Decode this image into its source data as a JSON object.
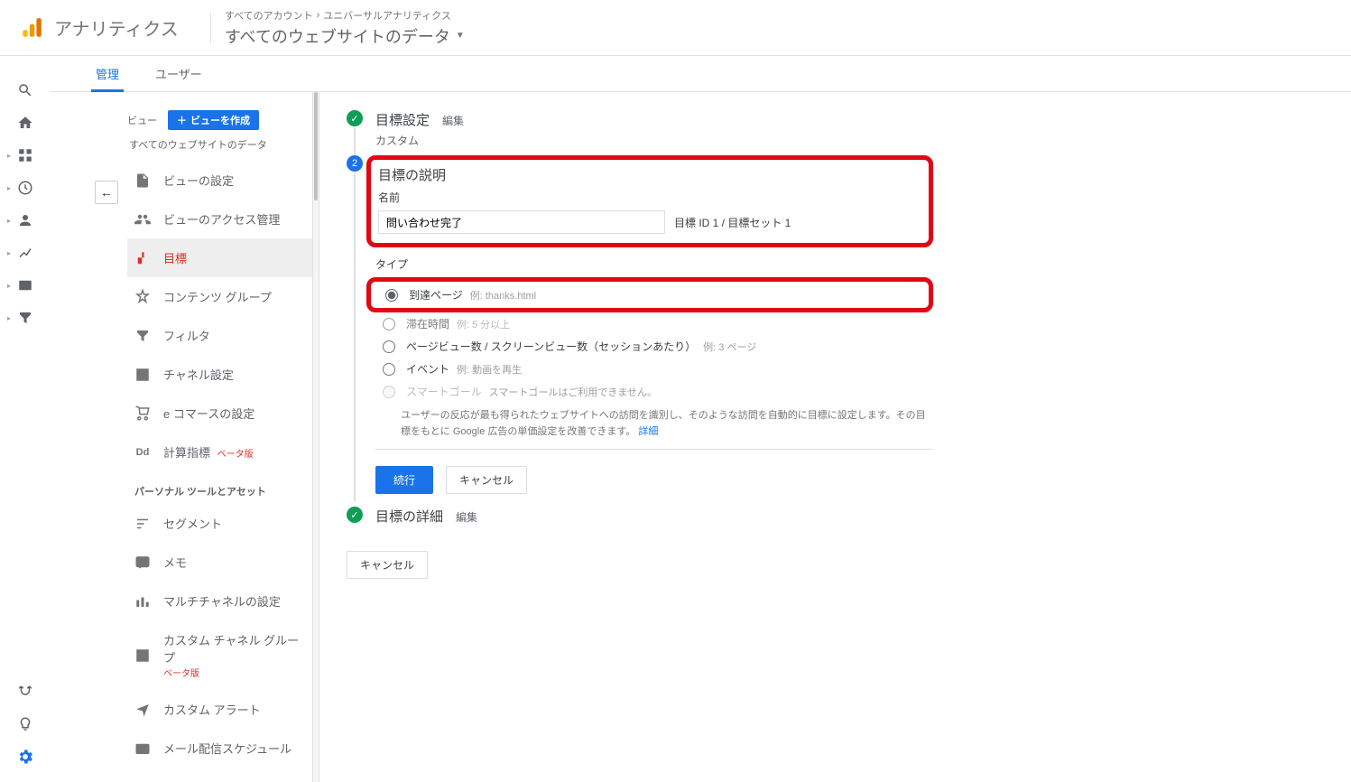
{
  "header": {
    "product": "アナリティクス",
    "breadcrumb_a": "すべてのアカウント",
    "breadcrumb_b": "ユニバーサルアナリティクス",
    "view_title": "すべてのウェブサイトのデータ"
  },
  "tabs": {
    "admin": "管理",
    "user": "ユーザー"
  },
  "admin_col": {
    "section": "ビュー",
    "create_btn": "ビューを作成",
    "subtitle": "すべてのウェブサイトのデータ",
    "items": [
      {
        "label": "ビューの設定"
      },
      {
        "label": "ビューのアクセス管理"
      },
      {
        "label": "目標"
      },
      {
        "label": "コンテンツ グループ"
      },
      {
        "label": "フィルタ"
      },
      {
        "label": "チャネル設定"
      },
      {
        "label": "e コマースの設定"
      },
      {
        "label": "計算指標"
      }
    ],
    "beta": "ベータ版",
    "personal_section": "パーソナル ツールとアセット",
    "personal_items": [
      {
        "label": "セグメント"
      },
      {
        "label": "メモ"
      },
      {
        "label": "マルチチャネルの設定"
      },
      {
        "label": "カスタム チャネル グループ"
      },
      {
        "label": "カスタム アラート"
      },
      {
        "label": "メール配信スケジュール"
      }
    ]
  },
  "steps": {
    "setup": {
      "title": "目標設定",
      "edit": "編集",
      "sub": "カスタム"
    },
    "describe": {
      "title": "目標の説明",
      "name_label": "名前",
      "name_value": "問い合わせ完了",
      "goal_id": "目標 ID 1 / 目標セット 1",
      "type_label": "タイプ",
      "types": {
        "destination": {
          "label": "到達ページ",
          "hint": "例: thanks.html"
        },
        "duration": {
          "label": "滞在時間",
          "hint": "例: 5 分以上"
        },
        "pages": {
          "label": "ページビュー数 / スクリーンビュー数（セッションあたり）",
          "hint": "例: 3 ページ"
        },
        "event": {
          "label": "イベント",
          "hint": "例: 動画を再生"
        },
        "smart": {
          "label": "スマートゴール",
          "hint": "スマートゴールはご利用できません。"
        }
      },
      "smart_desc": "ユーザーの反応が最も得られたウェブサイトへの訪問を識別し、そのような訪問を自動的に目標に設定します。その目標をもとに Google 広告の単価設定を改善できます。",
      "smart_link": "詳細",
      "continue": "続行",
      "cancel": "キャンセル"
    },
    "detail": {
      "title": "目標の詳細",
      "edit": "編集"
    }
  },
  "bottom_cancel": "キャンセル"
}
